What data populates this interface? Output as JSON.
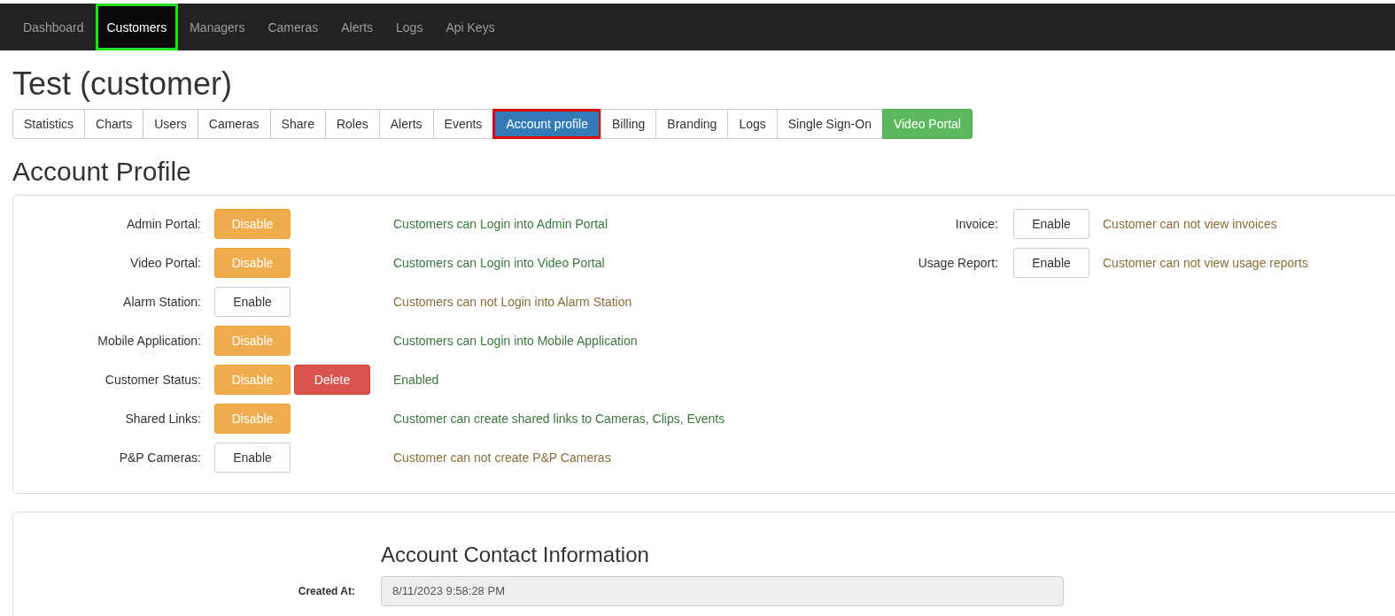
{
  "navbar": {
    "items": [
      {
        "label": "Dashboard",
        "selected": false,
        "highlighted": false
      },
      {
        "label": "Customers",
        "selected": true,
        "highlighted": true
      },
      {
        "label": "Managers",
        "selected": false,
        "highlighted": false
      },
      {
        "label": "Cameras",
        "selected": false,
        "highlighted": false
      },
      {
        "label": "Alerts",
        "selected": false,
        "highlighted": false
      },
      {
        "label": "Logs",
        "selected": false,
        "highlighted": false
      },
      {
        "label": "Api Keys",
        "selected": false,
        "highlighted": false
      }
    ]
  },
  "page_title": "Test (customer)",
  "tabs": [
    {
      "label": "Statistics",
      "selected": false,
      "kind": "default",
      "highlighted": false
    },
    {
      "label": "Charts",
      "selected": false,
      "kind": "default",
      "highlighted": false
    },
    {
      "label": "Users",
      "selected": false,
      "kind": "default",
      "highlighted": false
    },
    {
      "label": "Cameras",
      "selected": false,
      "kind": "default",
      "highlighted": false
    },
    {
      "label": "Share",
      "selected": false,
      "kind": "default",
      "highlighted": false
    },
    {
      "label": "Roles",
      "selected": false,
      "kind": "default",
      "highlighted": false
    },
    {
      "label": "Alerts",
      "selected": false,
      "kind": "default",
      "highlighted": false
    },
    {
      "label": "Events",
      "selected": false,
      "kind": "default",
      "highlighted": false
    },
    {
      "label": "Account profile",
      "selected": true,
      "kind": "default",
      "highlighted": true
    },
    {
      "label": "Billing",
      "selected": false,
      "kind": "default",
      "highlighted": false
    },
    {
      "label": "Branding",
      "selected": false,
      "kind": "default",
      "highlighted": false
    },
    {
      "label": "Logs",
      "selected": false,
      "kind": "default",
      "highlighted": false
    },
    {
      "label": "Single Sign-On",
      "selected": false,
      "kind": "default",
      "highlighted": false
    },
    {
      "label": "Video Portal",
      "selected": false,
      "kind": "success",
      "highlighted": false
    }
  ],
  "section_title": "Account Profile",
  "settings_left": [
    {
      "label": "Admin Portal:",
      "buttons": [
        {
          "label": "Disable",
          "kind": "warning"
        }
      ],
      "description": "Customers can Login into Admin Portal",
      "positive": true
    },
    {
      "label": "Video Portal:",
      "buttons": [
        {
          "label": "Disable",
          "kind": "warning"
        }
      ],
      "description": "Customers can Login into Video Portal",
      "positive": true
    },
    {
      "label": "Alarm Station:",
      "buttons": [
        {
          "label": "Enable",
          "kind": "default"
        }
      ],
      "description": "Customers can not Login into Alarm Station",
      "positive": false
    },
    {
      "label": "Mobile Application:",
      "buttons": [
        {
          "label": "Disable",
          "kind": "warning"
        }
      ],
      "description": "Customers can Login into Mobile Application",
      "positive": true
    },
    {
      "label": "Customer Status:",
      "buttons": [
        {
          "label": "Disable",
          "kind": "warning"
        },
        {
          "label": "Delete",
          "kind": "danger"
        }
      ],
      "description": "Enabled",
      "positive": true
    },
    {
      "label": "Shared Links:",
      "buttons": [
        {
          "label": "Disable",
          "kind": "warning"
        }
      ],
      "description": "Customer can create shared links to Cameras, Clips, Events",
      "positive": true
    },
    {
      "label": "P&P Cameras:",
      "buttons": [
        {
          "label": "Enable",
          "kind": "default"
        }
      ],
      "description": "Customer can not create P&P Cameras",
      "positive": false
    }
  ],
  "settings_right": [
    {
      "label": "Invoice:",
      "buttons": [
        {
          "label": "Enable",
          "kind": "default"
        }
      ],
      "description": "Customer can not view invoices",
      "positive": false
    },
    {
      "label": "Usage Report:",
      "buttons": [
        {
          "label": "Enable",
          "kind": "default"
        }
      ],
      "description": "Customer can not view usage reports",
      "positive": false
    }
  ],
  "contact": {
    "title": "Account Contact Information",
    "fields": [
      {
        "label": "Created At:",
        "value": "8/11/2023 9:58:28 PM"
      }
    ]
  }
}
